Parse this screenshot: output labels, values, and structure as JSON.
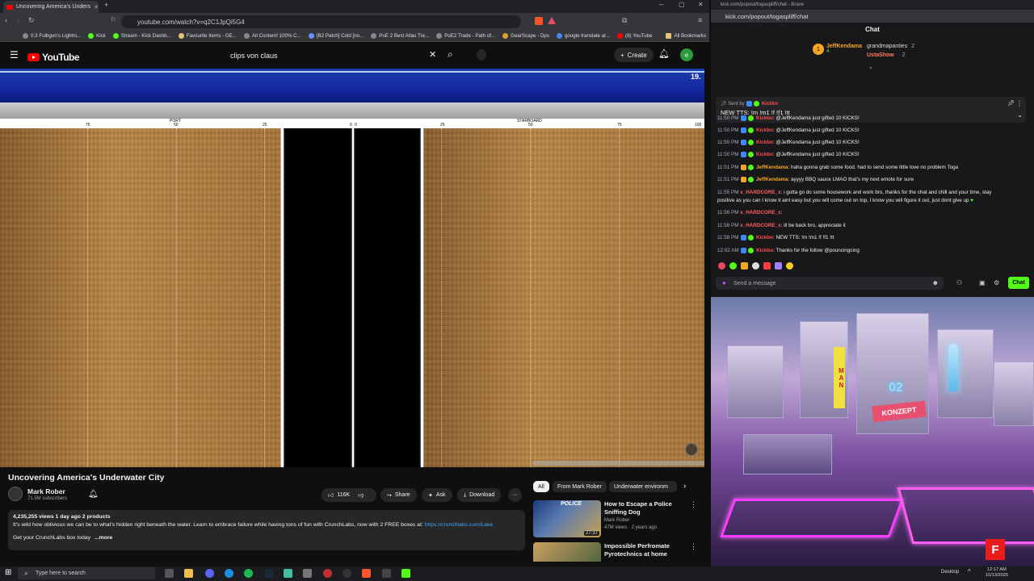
{
  "left_browser": {
    "tab_title": "Uncovering America's Unders",
    "url": "youtube.com/watch?v=q2C1JpQi5G4",
    "bookmarks": [
      "0.3 Fulbgun's Lightni...",
      "Kick",
      "Stream - Kick Dashb...",
      "Favourite Items - GE...",
      "All Content! 100% C...",
      "[B2 Patch] Cold [no...",
      "PoE 2 Best Atlas Tre...",
      "PoE2 Trade - Path of...",
      "GearScape - Dps",
      "google translate at...",
      "(8) YouTube",
      "All Bookmarks"
    ]
  },
  "youtube": {
    "logo": "YouTube",
    "search_value": "clips von claus",
    "create_label": "Create",
    "user_initial": "e",
    "video": {
      "depth_readout": "19.",
      "scale_labels": [
        "PORT",
        "STARBOARD"
      ],
      "tick_labels": [
        "75",
        "50",
        "25",
        "0",
        "0",
        "25",
        "50",
        "75",
        "100"
      ]
    },
    "title": "Uncovering America's Underwater City",
    "channel": "Mark Rober",
    "subscribers": "71.5M subscribers",
    "likes": "116K",
    "share_label": "Share",
    "ask_label": "Ask",
    "download_label": "Download",
    "description": {
      "stats": "4,235,255 views  1 day ago  2 products",
      "line1": "It's wild how oblivious we can be to what's hidden right beneath the water. Learn to embrace failure while having tons of fun with CrunchLabs, now with 2 FREE boxes at:",
      "link": "https://crunchlabs.com/Lake",
      "line2": "Get your CrunchLabs box today",
      "more": "...more"
    },
    "chips": [
      "All",
      "From Mark Rober",
      "Underwater environm"
    ],
    "recommendations": [
      {
        "title": "How to Escape a Police Sniffing Dog",
        "channel": "Mark Rober",
        "meta": "47M views · 2 years ago",
        "duration": "27:37",
        "thumb_text": "POLICE"
      },
      {
        "title": "Impossible Perfromate Pyrotechnics at home",
        "channel": "",
        "meta": "",
        "duration": "",
        "thumb_text": ""
      }
    ]
  },
  "right_browser": {
    "window_title": "kick.com/popout/togaspliff/chat - Brave",
    "url": "kick.com/popout/togaspliff/chat"
  },
  "chat": {
    "header": "Chat",
    "leaderboard": [
      {
        "name": "JeffKendama",
        "count": "4"
      },
      {
        "name": "grandmapanties",
        "count": "2"
      },
      {
        "name": "UstaShow",
        "count": "2"
      }
    ],
    "pinned_by": "Sent by",
    "pinned_user": "Kickbo",
    "pinned_text": "NEW TTS: !m !m1 !f !f1 !tt",
    "messages": [
      {
        "time": "11:50 PM",
        "user": "Kickbo",
        "text": ": @JeffKendama just gifted 10 KICKS!",
        "color": "#ff4d4d"
      },
      {
        "time": "11:50 PM",
        "user": "Kickbo",
        "text": ": @JeffKendama just gifted 10 KICKS!",
        "color": "#ff4d4d"
      },
      {
        "time": "11:50 PM",
        "user": "Kickbo",
        "text": ": @JeffKendama just gifted 10 KICKS!",
        "color": "#ff4d4d"
      },
      {
        "time": "11:50 PM",
        "user": "Kickbo",
        "text": ": @JeffKendama just gifted 10 KICKS!",
        "color": "#ff4d4d"
      },
      {
        "time": "11:51 PM",
        "user": "JeffKendama",
        "text": ": haha gonna grab some food. had to send some little love no problem Toga",
        "color": "#f5a623"
      },
      {
        "time": "11:51 PM",
        "user": "JeffKendama",
        "text": ": ayyyy BBQ sauce LMAO that's my next emote for sure",
        "color": "#f5a623"
      },
      {
        "time": "11:55 PM",
        "user": "x_HARDCORE_x",
        "text": ": i gotta go do some housework and work bro, thanks for the chat and chill and your time, stay",
        "color": "#ff5e5e"
      },
      {
        "time": "",
        "user": "",
        "text": "positive as you can I know it aint easy but you will come out on top, I know you will figure it out, just dont give up",
        "color": "#ffffff"
      },
      {
        "time": "11:56 PM",
        "user": "x_HARDCORE_x",
        "text": ":",
        "color": "#ff5e5e"
      },
      {
        "time": "11:58 PM",
        "user": "x_HARDCORE_x",
        "text": ": ill be back bro, appreciate it",
        "color": "#ff5e5e"
      },
      {
        "time": "11:58 PM",
        "user": "Kickbo",
        "text": ": NEW TTS: !m !m1 !f !f1 !tt",
        "color": "#ff4d4d"
      },
      {
        "time": "12:02 AM",
        "user": "Kickbo",
        "text": ": Thanks for the follow @pouncingcing",
        "color": "#ff4d4d"
      }
    ],
    "input_placeholder": "Send a message",
    "send_label": "Chat"
  },
  "scene": {
    "sign1": "KONZEPT",
    "sign2": "02",
    "sign3": "MAN"
  },
  "taskbar": {
    "search_placeholder": "Type here to search",
    "desktop_label": "Desktop",
    "time": "12:17 AM",
    "date": "10/13/2025"
  },
  "colors": {
    "youtube_red": "#ff0000",
    "kick_green": "#53fc18",
    "sand": "#b98746"
  }
}
